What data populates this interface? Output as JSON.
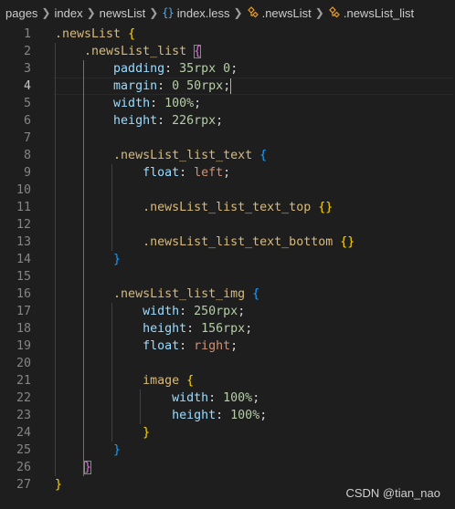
{
  "breadcrumb": {
    "items": [
      "pages",
      "index",
      "newsList",
      "index.less",
      ".newsList",
      ".newsList_list"
    ],
    "icons": [
      "",
      "",
      "",
      "braces-icon",
      "symbol-class-icon",
      "symbol-class-icon"
    ]
  },
  "editor": {
    "current_line": 4,
    "line_numbers": [
      "1",
      "2",
      "3",
      "4",
      "5",
      "6",
      "7",
      "8",
      "9",
      "10",
      "11",
      "12",
      "13",
      "14",
      "15",
      "16",
      "17",
      "18",
      "19",
      "20",
      "21",
      "22",
      "23",
      "24",
      "25",
      "26",
      "27"
    ],
    "lines": [
      {
        "selector": ".newsList",
        "open": "{"
      },
      {
        "selector": ".newsList_list",
        "open": "{"
      },
      {
        "prop": "padding",
        "colon": ": ",
        "num1": "35",
        "unit1": "rpx",
        "space": " ",
        "num2": "0",
        "semi": ";"
      },
      {
        "prop": "margin",
        "colon": ": ",
        "num1": "0",
        "space": " ",
        "num2": "50",
        "unit2": "rpx",
        "semi": ";"
      },
      {
        "prop": "width",
        "colon": ": ",
        "num1": "100",
        "unit1": "%",
        "semi": ";"
      },
      {
        "prop": "height",
        "colon": ": ",
        "num1": "226",
        "unit1": "rpx",
        "semi": ";"
      },
      {},
      {
        "selector": ".newsList_list_text",
        "open": "{"
      },
      {
        "prop": "float",
        "colon": ": ",
        "val": "left",
        "semi": ";"
      },
      {},
      {
        "selector": ".newsList_list_text_top",
        "open": "{",
        "close": "}"
      },
      {},
      {
        "selector": ".newsList_list_text_bottom",
        "open": "{",
        "close": "}"
      },
      {
        "close": "}"
      },
      {},
      {
        "selector": ".newsList_list_img",
        "open": "{"
      },
      {
        "prop": "width",
        "colon": ": ",
        "num1": "250",
        "unit1": "rpx",
        "semi": ";"
      },
      {
        "prop": "height",
        "colon": ": ",
        "num1": "156",
        "unit1": "rpx",
        "semi": ";"
      },
      {
        "prop": "float",
        "colon": ": ",
        "val": "right",
        "semi": ";"
      },
      {},
      {
        "selector": "image",
        "open": "{"
      },
      {
        "prop": "width",
        "colon": ": ",
        "num1": "100",
        "unit1": "%",
        "semi": ";"
      },
      {
        "prop": "height",
        "colon": ": ",
        "num1": "100",
        "unit1": "%",
        "semi": ";"
      },
      {
        "close": "}"
      },
      {
        "close": "}"
      },
      {
        "close": "}"
      },
      {
        "close": "}"
      }
    ]
  },
  "watermark": "CSDN @tian_nao",
  "colors": {
    "background": "#1e1e1e",
    "selector": "#d7ba7d",
    "property": "#9cdcfe",
    "number": "#b5cea8",
    "value": "#ce9178",
    "bracket_level1": "#ffd700",
    "bracket_level2": "#da70d6",
    "bracket_level3": "#179fff"
  }
}
